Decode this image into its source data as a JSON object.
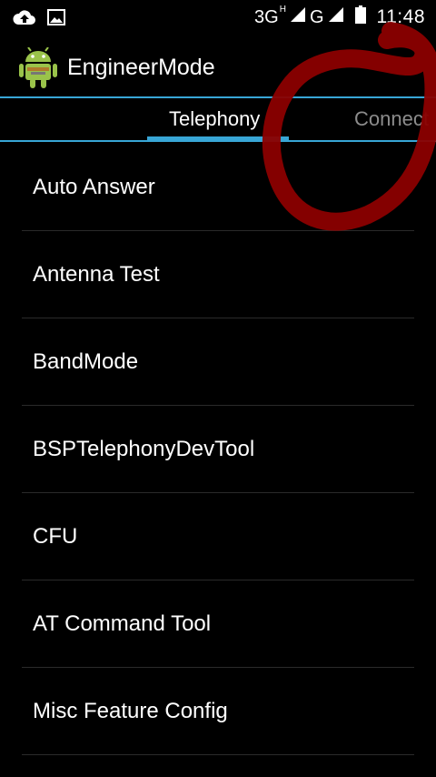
{
  "status_bar": {
    "network": "3G",
    "network_sup": "H",
    "network2": "G",
    "time": "11:48"
  },
  "app": {
    "title": "EngineerMode"
  },
  "tabs": [
    {
      "label": "Telephony",
      "selected": true
    },
    {
      "label": "Connect",
      "selected": false
    }
  ],
  "list": {
    "items": [
      {
        "label": "Auto Answer"
      },
      {
        "label": "Antenna Test"
      },
      {
        "label": "BandMode"
      },
      {
        "label": "BSPTelephonyDevTool"
      },
      {
        "label": "CFU"
      },
      {
        "label": "AT Command Tool"
      },
      {
        "label": "Misc Feature Config"
      }
    ]
  },
  "colors": {
    "background": "#000000",
    "accent": "#38a6d6",
    "annotation": "#8b0000",
    "android_green": "#9ac34a"
  }
}
